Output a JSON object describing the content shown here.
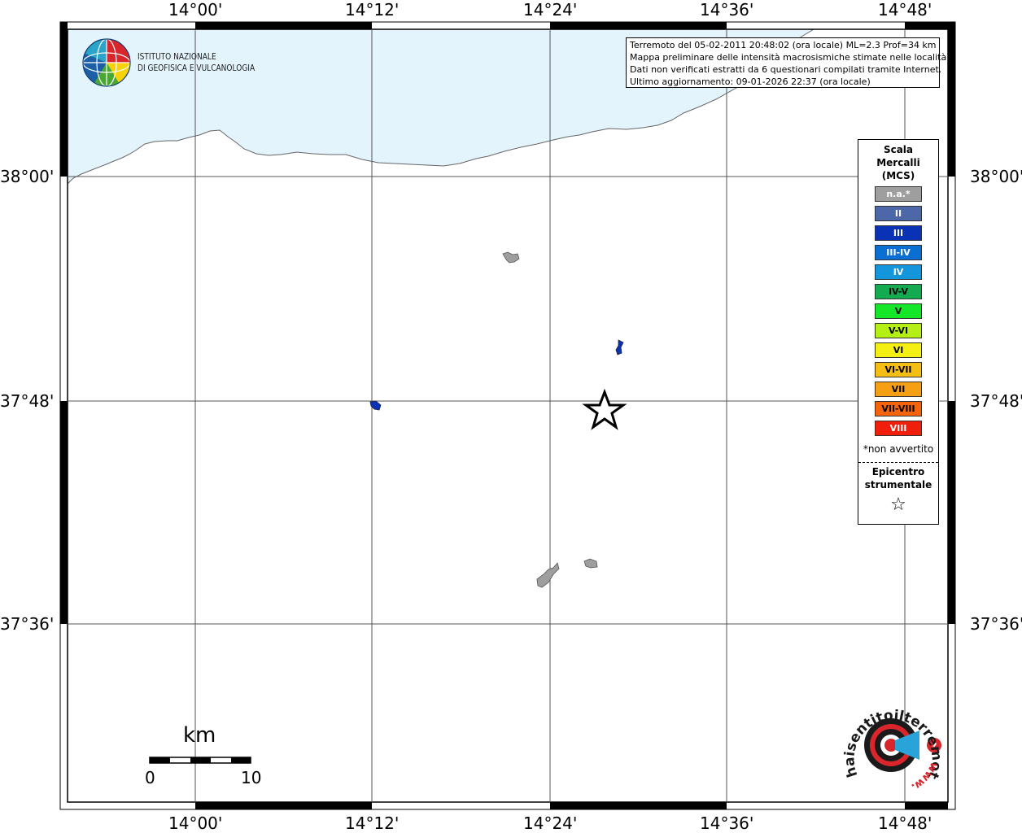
{
  "map": {
    "lon_labels": [
      "14°00'",
      "14°12'",
      "14°24'",
      "14°36'",
      "14°48'"
    ],
    "lat_labels": [
      "38°00'",
      "37°48'",
      "37°36'"
    ]
  },
  "info": {
    "line1": "Terremoto del 05-02-2011 20:48:02 (ora locale) ML=2.3 Prof=34 km",
    "line2": "Mappa preliminare delle intensità macrosismiche stimate nelle località",
    "line3": "Dati non verificati estratti da 6 questionari compilati tramite Internet.",
    "line4": "Ultimo aggiornamento: 09-01-2026 22:37 (ora locale)"
  },
  "logo": {
    "line1": "ISTITUTO NAZIONALE",
    "line2": "DI GEOFISICA E VULCANOLOGIA"
  },
  "legend": {
    "title_1": "Scala",
    "title_2": "Mercalli",
    "title_3": "(MCS)",
    "classes": [
      {
        "label": "n.a.*",
        "color": "#9e9e9e"
      },
      {
        "label": "II",
        "color": "#4d68a8"
      },
      {
        "label": "III",
        "color": "#0a32b4"
      },
      {
        "label": "III-IV",
        "color": "#0a6ed2"
      },
      {
        "label": "IV",
        "color": "#1496dc"
      },
      {
        "label": "IV-V",
        "color": "#14aa50"
      },
      {
        "label": "V",
        "color": "#14e628"
      },
      {
        "label": "V-VI",
        "color": "#b4f014"
      },
      {
        "label": "VI",
        "color": "#f5f014"
      },
      {
        "label": "VI-VII",
        "color": "#f5be14"
      },
      {
        "label": "VII",
        "color": "#f5a014"
      },
      {
        "label": "VII-VIII",
        "color": "#f5640a"
      },
      {
        "label": "VIII",
        "color": "#f01e0a"
      }
    ],
    "note": "*non avvertito",
    "epicenter_1": "Epicentro",
    "epicenter_2": "strumentale"
  },
  "scale_bar": {
    "unit": "km",
    "start": "0",
    "end": "10"
  },
  "colors": {
    "sea": "#e3f4fd",
    "land_outline": "#555555",
    "grid": "#555555",
    "intensity_iii": "#0a32b4",
    "na": "#9e9e9e"
  }
}
